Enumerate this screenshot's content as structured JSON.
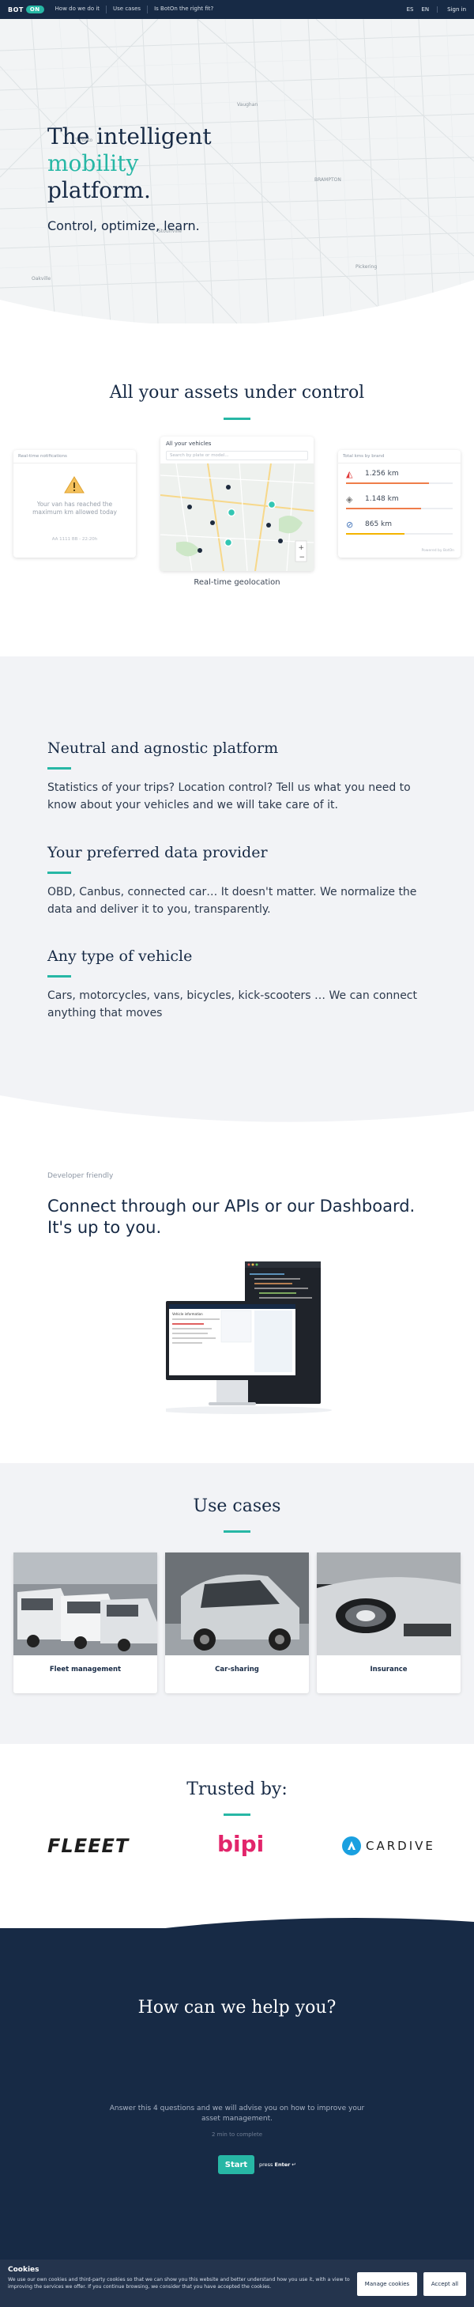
{
  "nav": {
    "logo_text": "BOT",
    "logo_pill": "ON",
    "links": [
      "How do we do it",
      "Use cases",
      "Is BotOn the right fit?"
    ],
    "lang_es": "ES",
    "lang_en": "EN",
    "signin": "Sign in"
  },
  "hero": {
    "title_line1": "The intelligent",
    "title_line2": "mobility",
    "title_line3": "platform.",
    "subtitle": "Control, optimize, learn.",
    "map_labels": [
      "BRAMPTON",
      "Toronto",
      "Stouffville",
      "Pickering",
      "Oakville",
      "Vaughan"
    ]
  },
  "assets": {
    "title": "All your assets under control",
    "notif_card": {
      "header": "Real-time notifications",
      "message": "Your van has reached the maximum km allowed today",
      "footer": "AA 1111 BB - 22:20h"
    },
    "vehicles_card": {
      "header": "All your vehicles",
      "search_placeholder": "Search by plate or model...",
      "caption": "Real-time geolocation"
    },
    "km_card": {
      "header": "Total kms by brand",
      "rows": [
        {
          "value": "1.256 km",
          "bar_color": "#ef7d4a",
          "fill": 0.78
        },
        {
          "value": "1.148 km",
          "bar_color": "#ef7d4a",
          "fill": 0.7
        },
        {
          "value": "865 km",
          "bar_color": "#f4b400",
          "fill": 0.55
        }
      ],
      "footer": "Powered by BotOn"
    }
  },
  "features": [
    {
      "title": "Neutral and agnostic platform",
      "text": "Statistics of your trips? Location control? Tell us what you need to know about your vehicles and we will take care of it."
    },
    {
      "title": "Your preferred data provider",
      "text": "OBD, Canbus, connected car… It doesn't matter. We normalize the data and deliver it to you, transparently."
    },
    {
      "title": "Any type of vehicle",
      "text": "Cars, motorcycles, vans, bicycles, kick-scooters … We can connect anything that moves"
    }
  ],
  "developer": {
    "eyebrow": "Developer friendly",
    "title": "Connect through our APIs or our Dashboard. It's up to you.",
    "screen_title": "Vehicle information"
  },
  "use_cases": {
    "title": "Use cases",
    "items": [
      {
        "label": "Fleet management"
      },
      {
        "label": "Car-sharing"
      },
      {
        "label": "Insurance"
      }
    ]
  },
  "trusted": {
    "title": "Trusted by:",
    "logos": [
      "FLEEET",
      "bipi",
      "CARDIVE"
    ]
  },
  "help": {
    "title": "How can we help you?",
    "text": "Answer this 4 questions and we will advise you on how to improve your asset management.",
    "time": "2 min to complete",
    "start": "Start",
    "press_prefix": "press",
    "press_key": "Enter",
    "press_icon": "↵"
  },
  "cookies": {
    "title": "Cookies",
    "text": "We use our own cookies and third-party cookies so that we can show you this website and better understand how you use it, with a view to improving the services we offer. If you continue browsing, we consider that you have accepted the cookies.",
    "manage": "Manage cookies",
    "accept": "Accept all"
  },
  "colors": {
    "navy": "#172a45",
    "teal": "#27b7a5",
    "light_bg": "#f2f3f6"
  }
}
